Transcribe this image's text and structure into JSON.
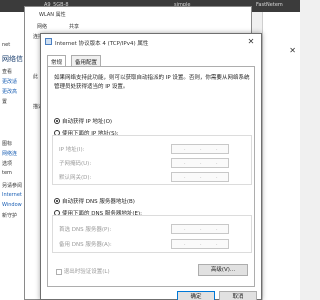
{
  "desktop_bar": {
    "left_text": "A9_5GB-8",
    "mid_text": "simple",
    "right_text": "FastNetem"
  },
  "bg_left": {
    "text_net": "net",
    "title": "网络信",
    "items": [
      "查看",
      "更改适",
      "更改高",
      "置"
    ],
    "links": [
      "图标",
      "网络连",
      "选项",
      "tem"
    ],
    "bottom": [
      "另请参阅",
      "Internet",
      "Window",
      "新守护"
    ]
  },
  "bg_right": {
    "close": "✕",
    "lines": [
      "",
      "",
      ""
    ]
  },
  "wlan": {
    "title": "WLAN 属性",
    "tabs": [
      "网络",
      "共享"
    ],
    "connect_label": "连接",
    "side_labels": [
      "此",
      "描述"
    ]
  },
  "dialog": {
    "title": "Internet 协议版本 4 (TCP/IPv4) 属性",
    "close": "✕",
    "tabs": {
      "general": "常规",
      "alternate": "备用配置"
    },
    "description": "如果网络支持此功能，则可以获取自动指派的 IP 设置。否则，你需要从网络系统管理员处获得适当的 IP 设置。",
    "ip_auto": "自动获得 IP 地址(O)",
    "ip_manual": "使用下面的 IP 地址(S):",
    "ip_address_label": "IP 地址(I):",
    "subnet_label": "子网掩码(U):",
    "gateway_label": "默认网关(D):",
    "dns_auto": "自动获得 DNS 服务器地址(B)",
    "dns_manual": "使用下面的 DNS 服务器地址(E):",
    "dns_pref_label": "首选 DNS 服务器(P):",
    "dns_alt_label": "备用 DNS 服务器(A):",
    "validate_label": "退出时验证设置(L)",
    "advanced_button": "高级(V)...",
    "ok_button": "确定",
    "cancel_button": "取消",
    "selected_ip_mode": "auto",
    "selected_dns_mode": "auto"
  }
}
